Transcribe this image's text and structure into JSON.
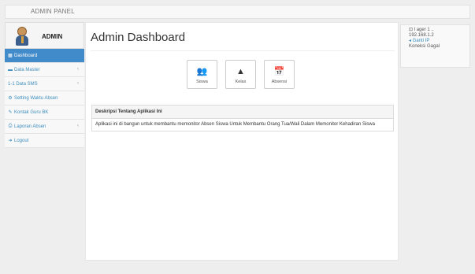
{
  "navbar": {
    "brand": "ADMIN PANEL"
  },
  "user": {
    "name": "ADMIN"
  },
  "sidebar": {
    "items": [
      {
        "icon": "▦",
        "label": "Dashboard",
        "caret": "",
        "active": true
      },
      {
        "icon": "▬",
        "label": "Data Master",
        "caret": "‹"
      },
      {
        "icon": "",
        "label": "1-1 Data SMS",
        "caret": "‹"
      },
      {
        "icon": "⚙",
        "label": "Setting Waktu Absen",
        "caret": ""
      },
      {
        "icon": "✎",
        "label": "Kontak Guru BK",
        "caret": ""
      },
      {
        "icon": "⎙",
        "label": "Laporan Absen",
        "caret": "‹"
      },
      {
        "icon": "➜",
        "label": "Logout",
        "caret": ""
      }
    ]
  },
  "main": {
    "title": "Admin Dashboard",
    "tiles": [
      {
        "icon": "👥",
        "label": "Siswa"
      },
      {
        "icon": "▲",
        "label": "Kelas"
      },
      {
        "icon": "📅",
        "label": "Absensi"
      }
    ],
    "panel": {
      "heading": "Deskripsi Tentang Aplikasi Ini",
      "body": "Aplikasi ini di bangun untuk membantu memonitor Absen Siswa Untuk Membantu Orang Tua/Wali Dalam Memonitor Kehadiran Siswa"
    }
  },
  "right_box": {
    "line1": "⊡ l ager 1 ..",
    "line2": "192.168.1.2",
    "line3": "◂ Ganti IP",
    "line4": "Koneksi Gagal"
  },
  "colors": {
    "accent": "#428bca",
    "link": "#3c8dbc"
  }
}
